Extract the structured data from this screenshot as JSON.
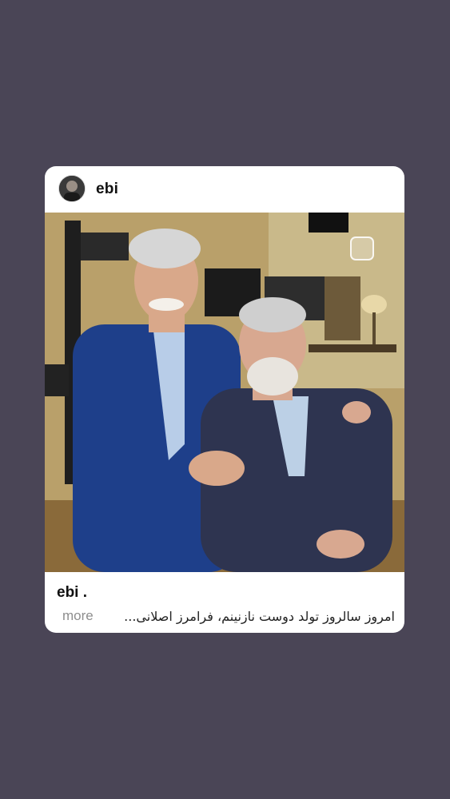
{
  "post": {
    "header_username": "ebi",
    "footer_username": "ebi .",
    "caption": "امروز سالروز تولد دوست نازنینم، فرامرز اصلانی...",
    "more_label": "more"
  },
  "icons": {
    "avatar": "profile-avatar",
    "share": "instagram-story-square-icon"
  },
  "colors": {
    "background": "#4a4556",
    "card": "#ffffff",
    "more_text": "#8e8e8e"
  }
}
